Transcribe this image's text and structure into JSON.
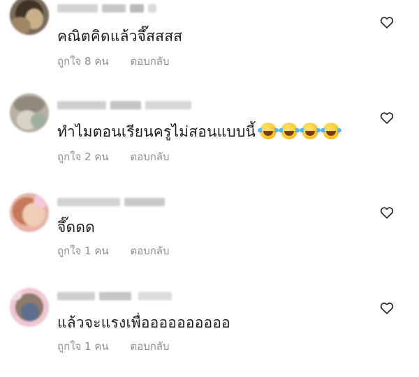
{
  "comments": [
    {
      "text": "คณิตคิดแล้วจึ๊สสสส",
      "emoji_count": 0,
      "likes": "ถูกใจ 8 คน",
      "reply": "ตอบกลับ"
    },
    {
      "text": "ทำไมตอนเรียนครูไม่สอนแบบนี้",
      "emoji_count": 4,
      "emoji": "face-with-tears-of-joy",
      "likes": "ถูกใจ 2 คน",
      "reply": "ตอบกลับ"
    },
    {
      "text": "จึ๊ดดด",
      "emoji_count": 0,
      "likes": "ถูกใจ 1 คน",
      "reply": "ตอบกลับ"
    },
    {
      "text": "แล้วจะแรงเพื่ออออออออออ",
      "emoji_count": 0,
      "likes": "ถูกใจ 1 คน",
      "reply": "ตอบกลับ"
    }
  ],
  "icons": {
    "like": "heart-outline-icon",
    "emoji": "face-with-tears-of-joy"
  },
  "colors": {
    "text": "#262626",
    "meta": "#8e8e8e",
    "heart_stroke": "#262626"
  }
}
